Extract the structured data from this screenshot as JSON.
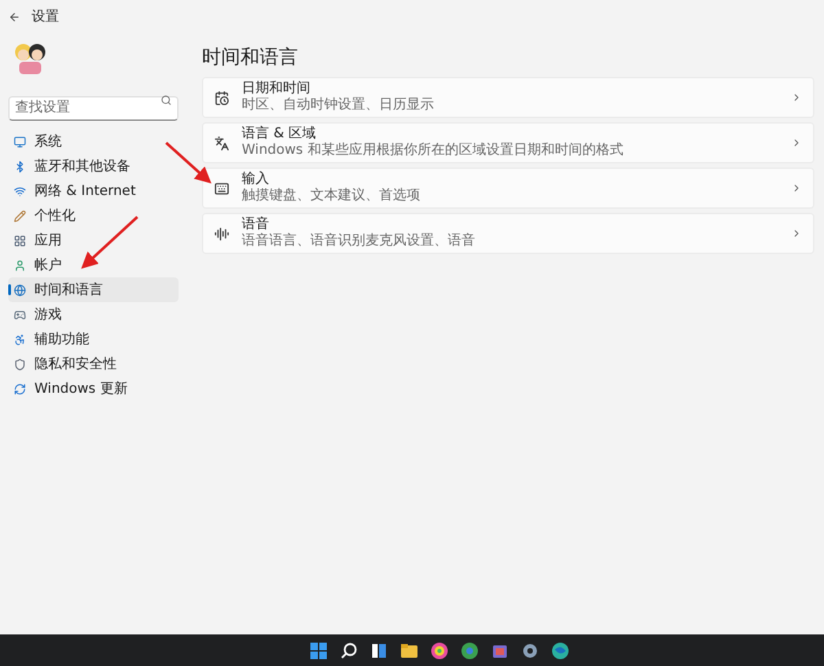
{
  "window": {
    "title": "设置"
  },
  "search": {
    "placeholder": "查找设置"
  },
  "sidebar": {
    "items": [
      {
        "label": "系统",
        "selected": false
      },
      {
        "label": "蓝牙和其他设备",
        "selected": false
      },
      {
        "label": "网络 & Internet",
        "selected": false
      },
      {
        "label": "个性化",
        "selected": false
      },
      {
        "label": "应用",
        "selected": false
      },
      {
        "label": "帐户",
        "selected": false
      },
      {
        "label": "时间和语言",
        "selected": true
      },
      {
        "label": "游戏",
        "selected": false
      },
      {
        "label": "辅助功能",
        "selected": false
      },
      {
        "label": "隐私和安全性",
        "selected": false
      },
      {
        "label": "Windows 更新",
        "selected": false
      }
    ]
  },
  "page_title": "时间和语言",
  "cards": [
    {
      "title": "日期和时间",
      "subtitle": "时区、自动时钟设置、日历显示"
    },
    {
      "title": "语言 & 区域",
      "subtitle": "Windows 和某些应用根据你所在的区域设置日期和时间的格式"
    },
    {
      "title": "输入",
      "subtitle": "触摸键盘、文本建议、首选项"
    },
    {
      "title": "语音",
      "subtitle": "语音语言、语音识别麦克风设置、语音"
    }
  ]
}
